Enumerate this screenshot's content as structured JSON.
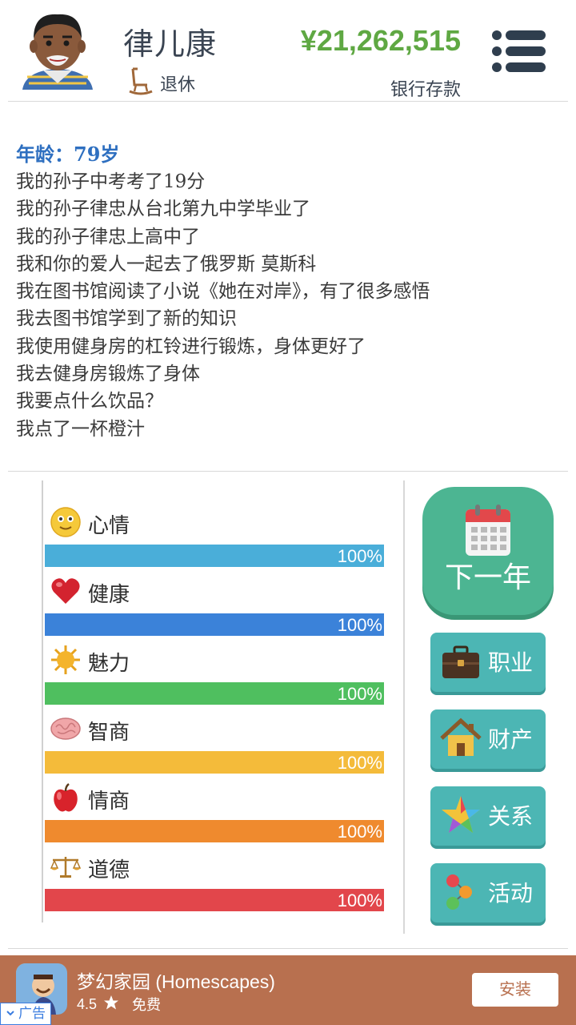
{
  "header": {
    "name": "律儿康",
    "status": "退休",
    "money": "¥21,262,515",
    "money_label": "银行存款"
  },
  "log": {
    "age": "年龄：79岁",
    "lines": [
      "我的孙子中考考了19分",
      "我的孙子律忠从台北第九中学毕业了",
      "我的孙子律忠上高中了",
      "我和你的爱人一起去了俄罗斯 莫斯科",
      "我在图书馆阅读了小说《她在对岸》，有了很多感悟",
      "我去图书馆学到了新的知识",
      "我使用健身房的杠铃进行锻炼，身体更好了",
      "我去健身房锻炼了身体",
      "我要点什么饮品？",
      "我点了一杯橙汁"
    ]
  },
  "stats": [
    {
      "label": "心情",
      "percent": "100%",
      "value": 1.0,
      "color": "#4aaed9",
      "icon": "smiley-icon"
    },
    {
      "label": "健康",
      "percent": "100%",
      "value": 1.0,
      "color": "#3b82d9",
      "icon": "heart-icon"
    },
    {
      "label": "魅力",
      "percent": "100%",
      "value": 1.0,
      "color": "#4fbf5f",
      "icon": "sun-icon"
    },
    {
      "label": "智商",
      "percent": "100%",
      "value": 1.0,
      "color": "#f4bb3a",
      "icon": "brain-icon"
    },
    {
      "label": "情商",
      "percent": "100%",
      "value": 1.0,
      "color": "#ef8a2e",
      "icon": "apple-icon"
    },
    {
      "label": "道德",
      "percent": "100%",
      "value": 1.0,
      "color": "#e2464b",
      "icon": "scales-icon"
    }
  ],
  "actions": {
    "next_year": "下一年",
    "career": "职业",
    "property": "财产",
    "relations": "关系",
    "activities": "活动"
  },
  "ad": {
    "title": "梦幻家园 (Homescapes)",
    "rating": "4.5",
    "price": "免费",
    "install": "安装",
    "tag": "广告"
  }
}
